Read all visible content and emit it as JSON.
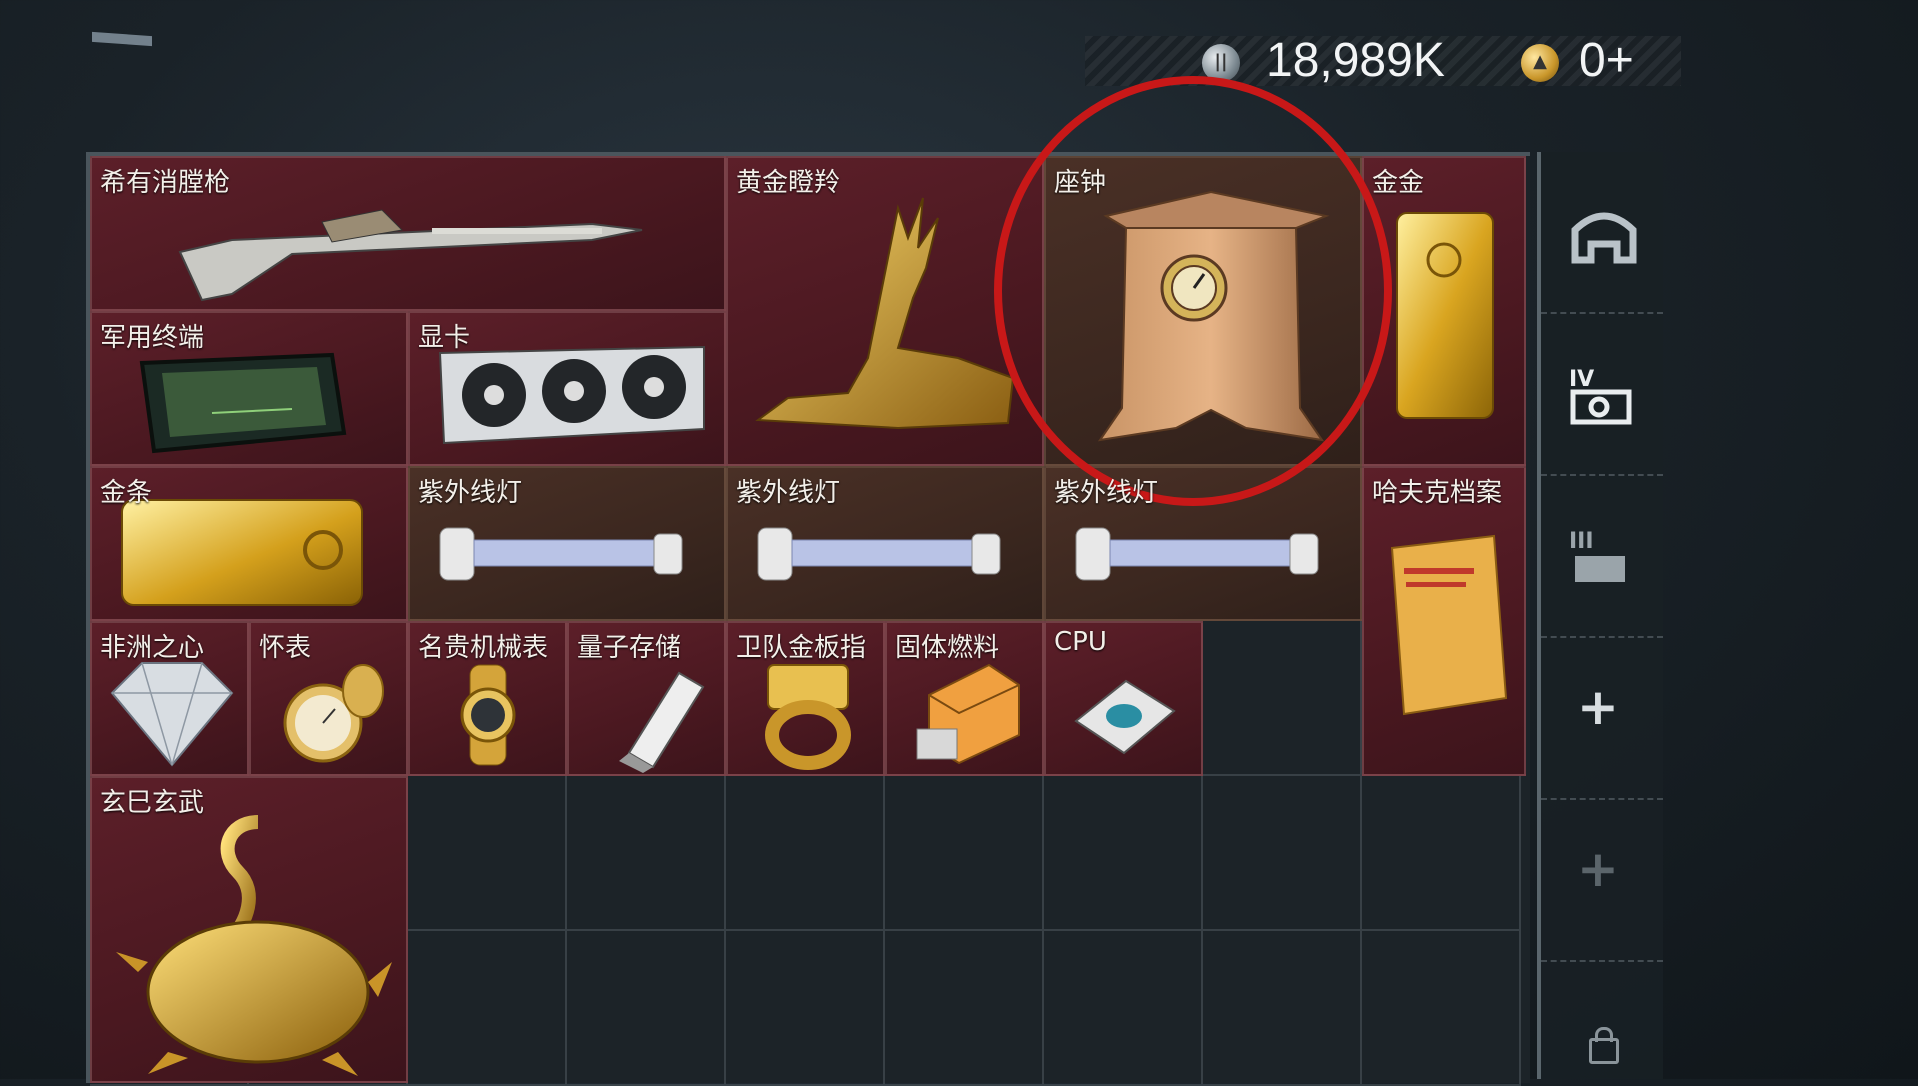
{
  "currency": {
    "coins_value": "18,989K",
    "premium_value": "0+",
    "coins_icon": "silver-coin-icon",
    "premium_icon": "gold-triangle-coin-icon"
  },
  "items": {
    "rifle": "希有消膛枪",
    "golden_deer": "黄金瞪羚",
    "clock": "座钟",
    "gold_bar_small": "金金",
    "military_terminal": "军用终端",
    "graphics_card": "显卡",
    "gold_bar": "金条",
    "uv_lamp_1": "紫外线灯",
    "uv_lamp_2": "紫外线灯",
    "uv_lamp_3": "紫外线灯",
    "dossier": "哈夫克档案",
    "diamond": "非洲之心",
    "pocket_watch": "怀表",
    "luxury_watch": "名贵机械表",
    "quantum_storage": "量子存储",
    "gold_ring": "卫队金板指",
    "solid_fuel": "固体燃料",
    "cpu": "CPU",
    "golden_dragon": "玄巳玄武"
  },
  "sidebar": {
    "icons": [
      "helmet-icon",
      "armor-level-iv-icon",
      "armor-level-iii-icon",
      "add-slot-icon",
      "add-slot-icon",
      "lock-icon"
    ]
  },
  "colors": {
    "rare_item_bg": "#4a1820",
    "highlight": "#c81818"
  }
}
